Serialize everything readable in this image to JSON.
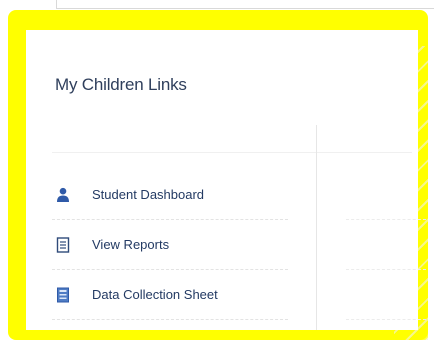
{
  "panel": {
    "title": "My Children Links"
  },
  "links": [
    {
      "label": "Student Dashboard",
      "icon": "person-icon"
    },
    {
      "label": "View Reports",
      "icon": "document-icon"
    },
    {
      "label": "Data Collection Sheet",
      "icon": "sheet-icon"
    }
  ],
  "colors": {
    "highlight": "#ffff00",
    "title": "#2f3f5c",
    "link": "#233a63",
    "icon": "#2f5aa8"
  }
}
